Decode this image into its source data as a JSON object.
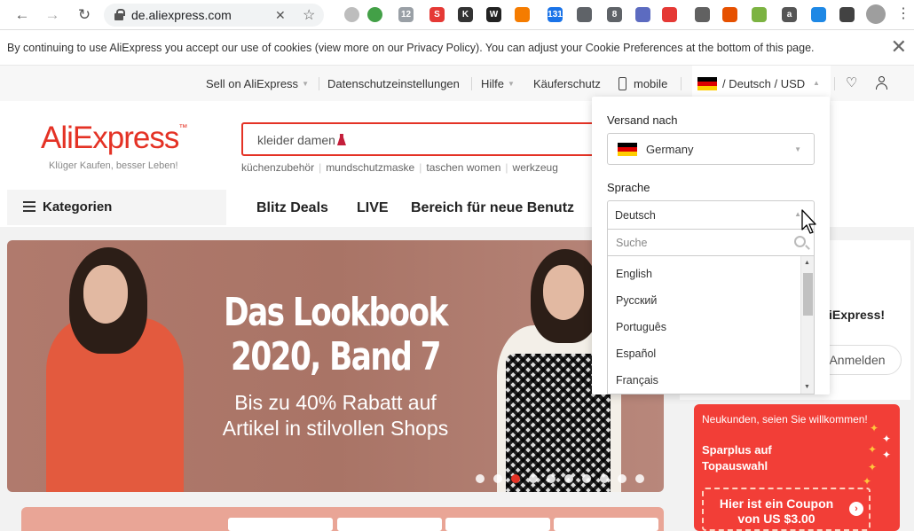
{
  "browser": {
    "url": "de.aliexpress.com",
    "extensions": [
      {
        "label": "12",
        "color": "#9aa0a6"
      },
      {
        "label": "S",
        "color": "#e53935"
      },
      {
        "label": "K",
        "color": "#333333"
      },
      {
        "label": "W",
        "color": "#222222"
      },
      {
        "label": "131",
        "color": "#1a73e8"
      },
      {
        "label": "8",
        "color": "#5f6368"
      },
      {
        "label": "a",
        "color": "#555555"
      }
    ]
  },
  "cookie": {
    "text": "By continuing to use AliExpress you accept our use of cookies (view more on our Privacy Policy). You can adjust your Cookie Preferences at the bottom of this page."
  },
  "toplinks": {
    "sell": "Sell on AliExpress",
    "privacy": "Datenschutzeinstellungen",
    "help": "Hilfe",
    "protection": "Käuferschutz",
    "mobile": "mobile",
    "locale": "/ Deutsch /  USD"
  },
  "header": {
    "logo": "AliExpress",
    "logo_tm": "™",
    "tagline": "Klüger Kaufen, besser Leben!",
    "search_value": "kleider damen",
    "hot_searches": [
      "küchenzubehör",
      "mundschutzmaske",
      "taschen women",
      "werkzeug"
    ]
  },
  "nav": {
    "categories": "Kategorien",
    "links": [
      "Blitz Deals",
      "LIVE",
      "Bereich für neue Benutz"
    ]
  },
  "banner": {
    "line1": "Das Lookbook",
    "line2": "2020, Band 7",
    "line3": "Bis zu 40% Rabatt auf",
    "line4": "Artikel in stilvollen Shops",
    "dot_count": 10,
    "active_dot": 2
  },
  "right_panel": {
    "welcome": "iExpress!",
    "login": "Anmelden"
  },
  "promo": {
    "line1": "Neukunden, seien Sie willkommen!",
    "line2": "Sparplus auf Topauswahl",
    "coupon": "Hier ist ein Coupon von US $3.00"
  },
  "dropdown": {
    "ship_label": "Versand nach",
    "country": "Germany",
    "lang_label": "Sprache",
    "lang_value": "Deutsch",
    "search_placeholder": "Suche",
    "languages": [
      "English",
      "Русский",
      "Português",
      "Español",
      "Français"
    ]
  },
  "colors": {
    "accent": "#e43225",
    "promo": "#f23e37"
  }
}
